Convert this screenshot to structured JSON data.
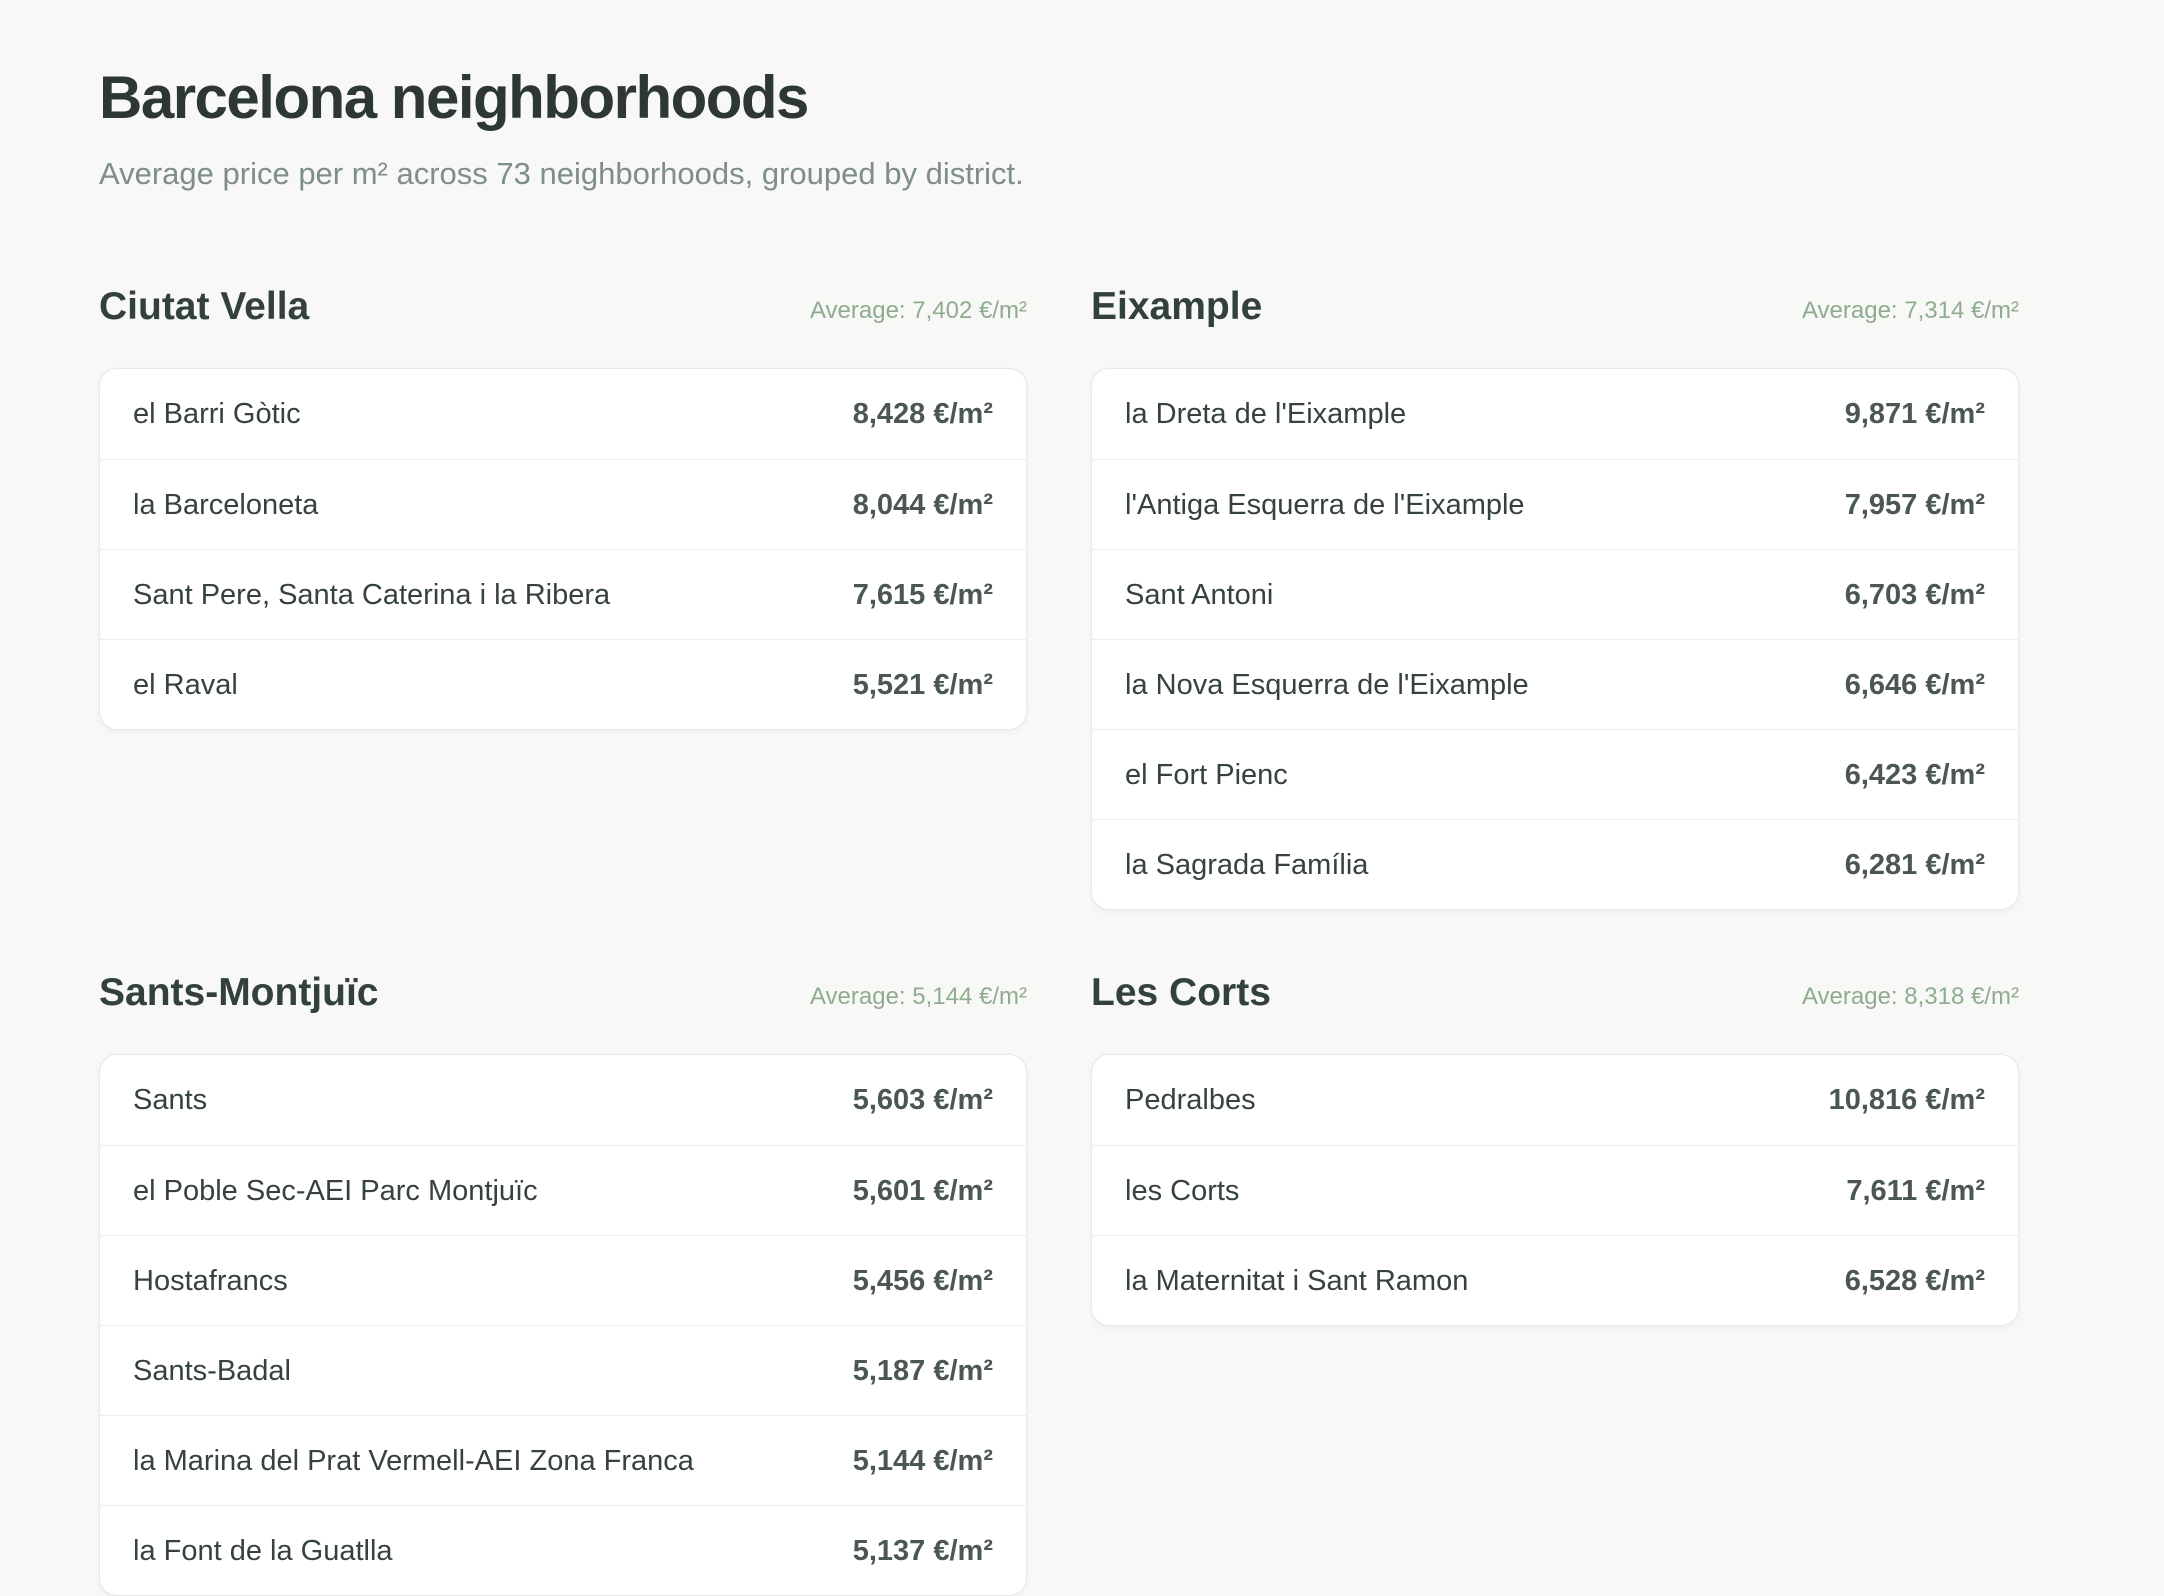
{
  "header": {
    "title": "Barcelona neighborhoods",
    "subtitle": "Average price per m² across 73 neighborhoods, grouped by district."
  },
  "districts": [
    {
      "name": "Ciutat Vella",
      "average": "Average: 7,402 €/m²",
      "neighborhoods": [
        {
          "name": "el Barri Gòtic",
          "price": "8,428 €/m²"
        },
        {
          "name": "la Barceloneta",
          "price": "8,044 €/m²"
        },
        {
          "name": "Sant Pere, Santa Caterina i la Ribera",
          "price": "7,615 €/m²"
        },
        {
          "name": "el Raval",
          "price": "5,521 €/m²"
        }
      ]
    },
    {
      "name": "Eixample",
      "average": "Average: 7,314 €/m²",
      "neighborhoods": [
        {
          "name": "la Dreta de l'Eixample",
          "price": "9,871 €/m²"
        },
        {
          "name": "l'Antiga Esquerra de l'Eixample",
          "price": "7,957 €/m²"
        },
        {
          "name": "Sant Antoni",
          "price": "6,703 €/m²"
        },
        {
          "name": "la Nova Esquerra de l'Eixample",
          "price": "6,646 €/m²"
        },
        {
          "name": "el Fort Pienc",
          "price": "6,423 €/m²"
        },
        {
          "name": "la Sagrada Família",
          "price": "6,281 €/m²"
        }
      ]
    },
    {
      "name": "Sants-Montjuïc",
      "average": "Average: 5,144 €/m²",
      "neighborhoods": [
        {
          "name": "Sants",
          "price": "5,603 €/m²"
        },
        {
          "name": "el Poble Sec-AEI Parc Montjuïc",
          "price": "5,601 €/m²"
        },
        {
          "name": "Hostafrancs",
          "price": "5,456 €/m²"
        },
        {
          "name": "Sants-Badal",
          "price": "5,187 €/m²"
        },
        {
          "name": "la Marina del Prat Vermell-AEI Zona Franca",
          "price": "5,144 €/m²"
        },
        {
          "name": "la Font de la Guatlla",
          "price": "5,137 €/m²"
        }
      ]
    },
    {
      "name": "Les Corts",
      "average": "Average: 8,318 €/m²",
      "neighborhoods": [
        {
          "name": "Pedralbes",
          "price": "10,816 €/m²"
        },
        {
          "name": "les Corts",
          "price": "7,611 €/m²"
        },
        {
          "name": "la Maternitat i Sant Ramon",
          "price": "6,528 €/m²"
        }
      ]
    }
  ]
}
